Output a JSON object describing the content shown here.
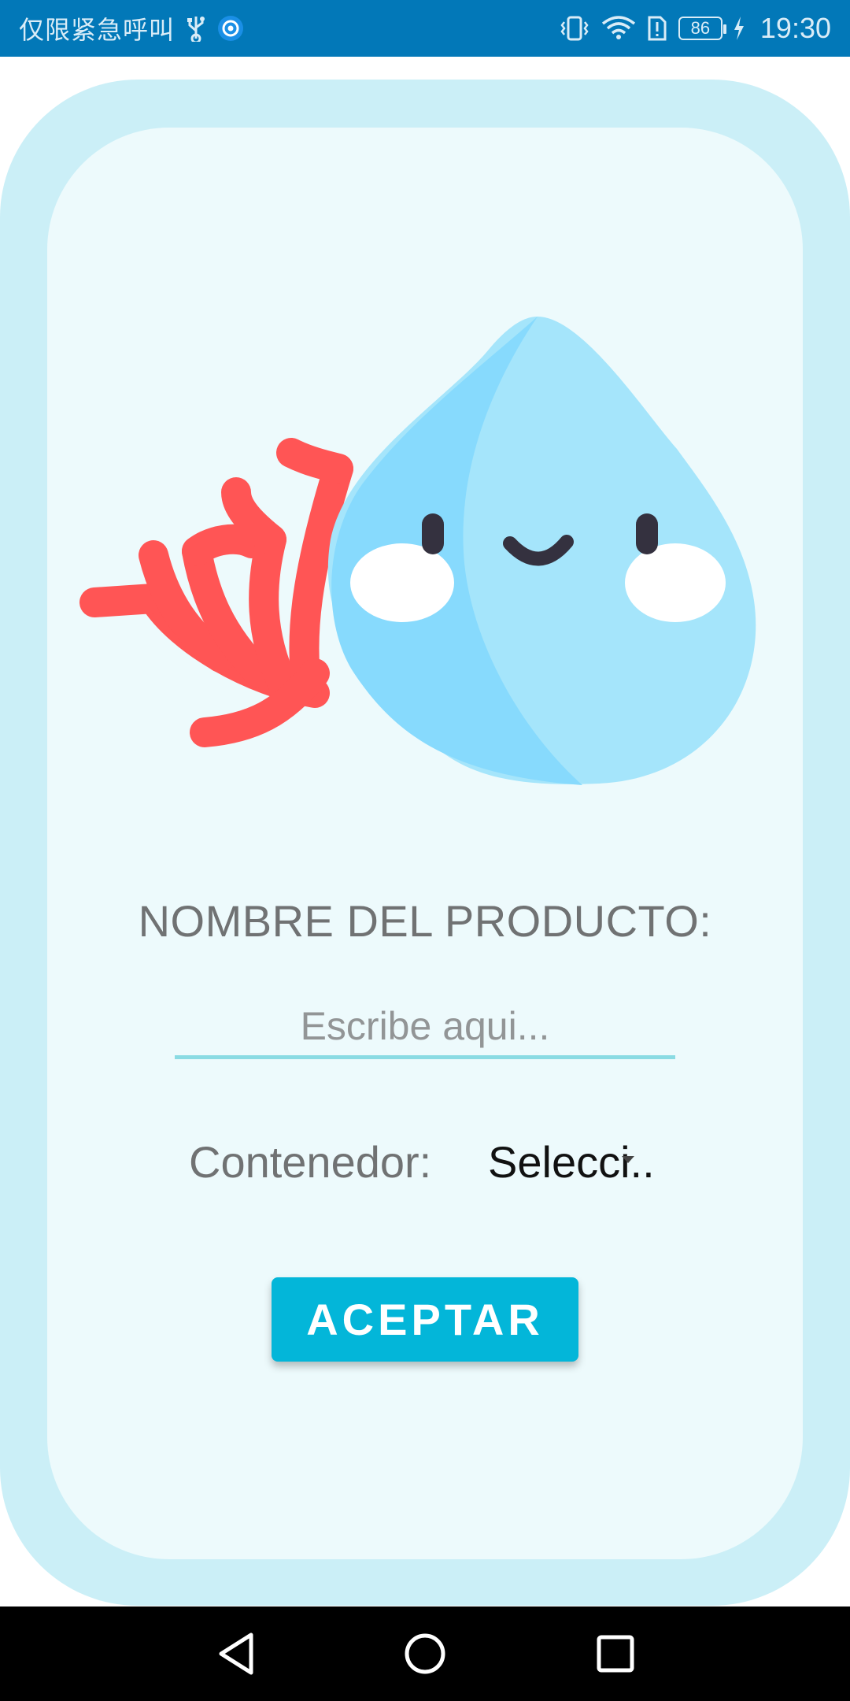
{
  "status_bar": {
    "carrier": "仅限紧急呼叫",
    "battery": "86",
    "time": "19:30",
    "background": "#0278b8",
    "icons": [
      "usb-icon",
      "app-notification-icon",
      "vibrate-icon",
      "wifi-icon",
      "sim-alert-icon",
      "battery-icon",
      "charging-icon"
    ]
  },
  "form": {
    "product_label": "NOMBRE DEL PRODUCTO:",
    "product_placeholder": "Escribe aqui...",
    "product_value": "",
    "container_label": "Contenedor:",
    "container_selected": "Selecci..",
    "accept_label": "ACEPTAR",
    "accent": "#03b6d9",
    "input_underline": "#8adbe3"
  },
  "illustration": {
    "icon": "water-drop-mascot-with-coral-icon",
    "colors": {
      "drop": "#a5e5fb",
      "drop_shade": "#87dafd",
      "coral": "#ff5555",
      "face": "#34313f"
    }
  },
  "nav_bar": {
    "icons": [
      "back-icon",
      "home-icon",
      "recents-icon"
    ]
  }
}
